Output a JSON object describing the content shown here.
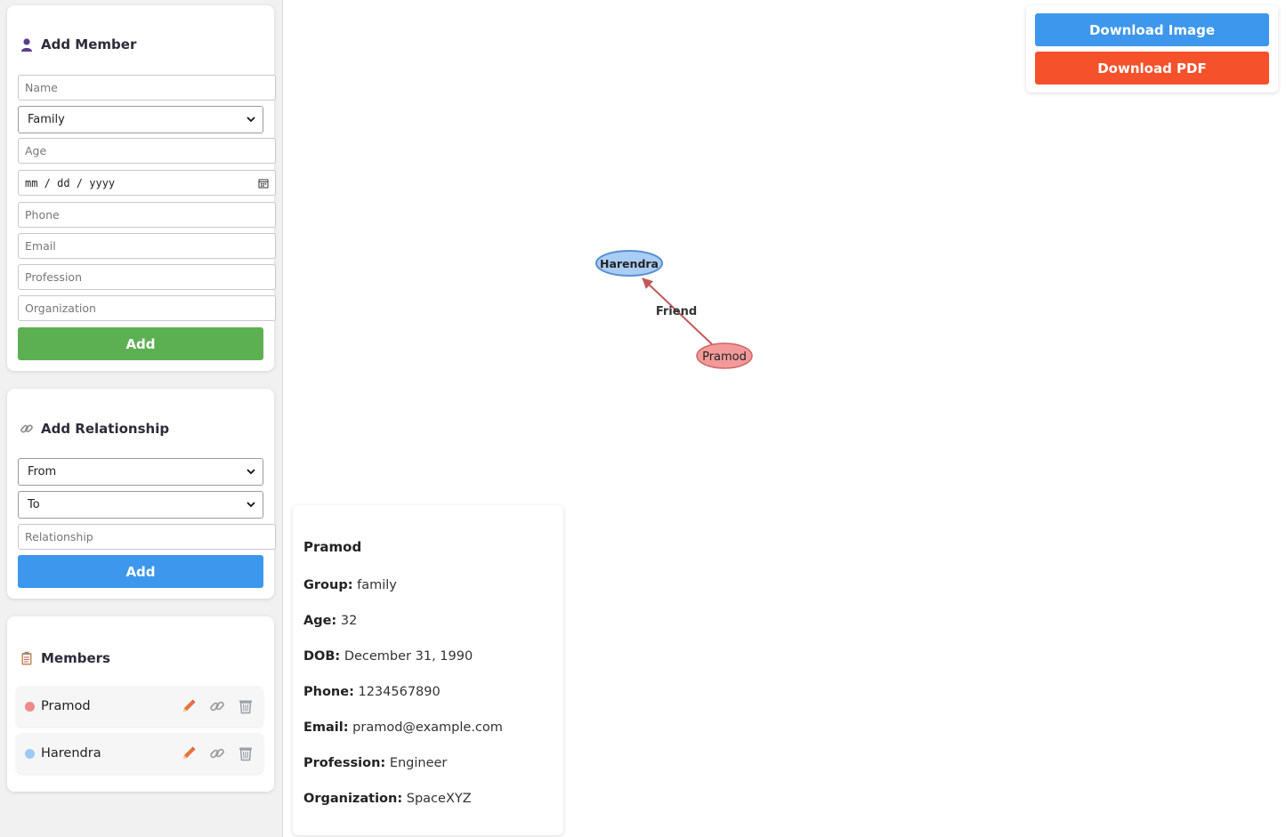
{
  "add_member": {
    "title": "Add Member",
    "name_placeholder": "Name",
    "group_selected": "Family",
    "age_placeholder": "Age",
    "dob_placeholder": "mm / dd / yyyy",
    "phone_placeholder": "Phone",
    "email_placeholder": "Email",
    "profession_placeholder": "Profession",
    "organization_placeholder": "Organization",
    "add_label": "Add"
  },
  "add_relationship": {
    "title": "Add Relationship",
    "from_selected": "From",
    "to_selected": "To",
    "relationship_placeholder": "Relationship",
    "add_label": "Add"
  },
  "members": {
    "title": "Members",
    "items": [
      {
        "name": "Pramod",
        "color": "#f08a8a"
      },
      {
        "name": "Harendra",
        "color": "#9ccaf5"
      }
    ]
  },
  "download": {
    "image_label": "Download Image",
    "image_color": "#3d97ec",
    "pdf_label": "Download PDF",
    "pdf_color": "#f5512b"
  },
  "graph": {
    "nodes": [
      {
        "label": "Harendra",
        "fill": "#a9cdf5",
        "stroke": "#5a8fd0"
      },
      {
        "label": "Pramod",
        "fill": "#f29a9a",
        "stroke": "#d06464"
      }
    ],
    "edge": {
      "from": "Pramod",
      "to": "Harendra",
      "label": "Friend",
      "color": "#c0585a"
    }
  },
  "details": {
    "name": "Pramod",
    "group_label": "Group:",
    "group": "family",
    "age_label": "Age:",
    "age": "32",
    "dob_label": "DOB:",
    "dob": "December 31, 1990",
    "phone_label": "Phone:",
    "phone": "1234567890",
    "email_label": "Email:",
    "email": "pramod@example.com",
    "profession_label": "Profession:",
    "profession": "Engineer",
    "organization_label": "Organization:",
    "organization": "SpaceXYZ"
  }
}
